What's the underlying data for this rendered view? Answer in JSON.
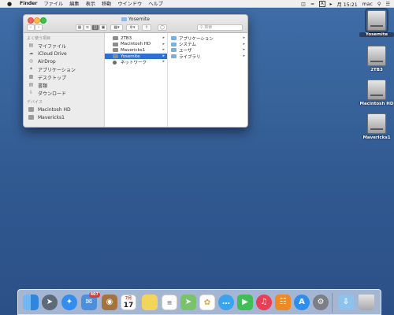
{
  "menubar": {
    "apple": "",
    "items": [
      "Finder",
      "ファイル",
      "編集",
      "表示",
      "移動",
      "ウインドウ",
      "ヘルプ"
    ],
    "ime": "A",
    "clock": "月 15:21",
    "user": "mac"
  },
  "window": {
    "title": "Yosemite",
    "search_placeholder": "検索",
    "sidebar": {
      "favorites_header": "よく使う項目",
      "favorites": [
        "マイファイル",
        "iCloud Drive",
        "AirDrop",
        "アプリケーション",
        "デスクトップ",
        "書類",
        "ダウンロード"
      ],
      "devices_header": "デバイス",
      "devices": [
        "Macintosh HD",
        "Mavericks1"
      ]
    },
    "column1": [
      "2TB3",
      "Macintosh HD",
      "Mavericks1",
      "Yosemite",
      "ネットワーク"
    ],
    "column1_selected": "Yosemite",
    "column2": [
      "アプリケーション",
      "システム",
      "ユーザ",
      "ライブラリ"
    ]
  },
  "desktop_icons": [
    "Yosemite",
    "2TB3",
    "Macintosh HD",
    "Mavericks1"
  ],
  "dock": {
    "apps": [
      "finder-icon",
      "launchpad-icon",
      "safari-icon",
      "mail-icon",
      "contacts-icon",
      "calendar-icon",
      "notes-icon",
      "reminders-icon",
      "maps-icon",
      "photos-icon",
      "messages-icon",
      "facetime-icon",
      "itunes-icon",
      "ibooks-icon",
      "appstore-icon",
      "system-preferences-icon",
      "downloads-folder-icon",
      "trash-icon"
    ],
    "calendar_month": "7月",
    "calendar_day": "17",
    "mail_badge": "407"
  }
}
